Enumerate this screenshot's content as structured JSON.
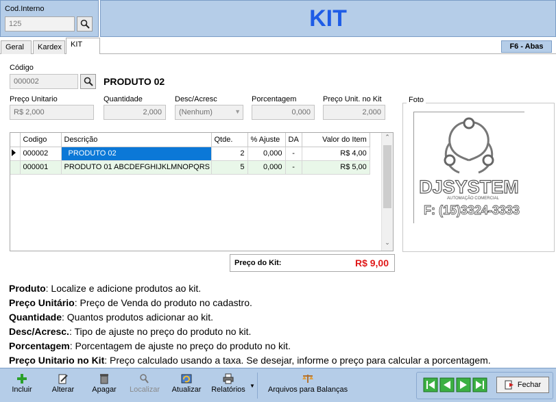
{
  "header": {
    "cod_interno_label": "Cod.Interno",
    "cod_interno_value": "125",
    "title": "KIT"
  },
  "tabs": [
    {
      "label": "Geral"
    },
    {
      "label": "Kardex"
    },
    {
      "label": "KIT"
    }
  ],
  "f6_label": "F6  - Abas",
  "form": {
    "codigo_label": "Código",
    "codigo_value": "000002",
    "product_name": "PRODUTO 02",
    "preco_unitario_label": "Preço Unitario",
    "preco_unitario_value": "R$ 2,000",
    "quantidade_label": "Quantidade",
    "quantidade_value": "2,000",
    "desc_acresc_label": "Desc/Acresc",
    "desc_acresc_value": "(Nenhum)",
    "porcentagem_label": "Porcentagem",
    "porcentagem_value": "0,000",
    "preco_kit_label": "Preço Unit. no Kit",
    "preco_kit_value": "2,000",
    "foto_label": "Foto"
  },
  "grid": {
    "columns": [
      "Codigo",
      "Descrição",
      "Qtde.",
      "% Ajuste",
      "DA",
      "Valor do Item"
    ],
    "rows": [
      {
        "codigo": "000002",
        "descricao": "PRODUTO 02",
        "qtde": "2",
        "ajuste": "0,000",
        "da": "-",
        "valor": "R$ 4,00"
      },
      {
        "codigo": "000001",
        "descricao": "PRODUTO 01 ABCDEFGHIJKLMNOPQRS",
        "qtde": "5",
        "ajuste": "0,000",
        "da": "-",
        "valor": "R$ 5,00"
      }
    ]
  },
  "price_total": {
    "label": "Preço do Kit:",
    "value": "R$ 9,00"
  },
  "logo": {
    "name": "DJSYSTEM",
    "tagline": "AUTOMAÇÃO COMERCIAL",
    "phone": "F: (15)3324-3333"
  },
  "help": [
    {
      "term": "Produto",
      "text": ": Localize e adicione produtos ao kit."
    },
    {
      "term": "Preço Unitário",
      "text": ": Preço de Venda do produto no cadastro."
    },
    {
      "term": "Quantidade",
      "text": ": Quantos produtos adicionar ao kit."
    },
    {
      "term": "Desc/Acresc.",
      "text": ": Tipo de ajuste no preço do produto no kit."
    },
    {
      "term": "Porcentagem",
      "text": ": Porcentagem de ajuste no preço do produto no kit."
    },
    {
      "term": "Preço Unitario no Kit",
      "text": ": Preço calculado usando a taxa. Se desejar, informe o preço para calcular a porcentagem."
    }
  ],
  "toolbar": {
    "incluir": "Incluir",
    "alterar": "Alterar",
    "apagar": "Apagar",
    "localizar": "Localizar",
    "atualizar": "Atualizar",
    "relatorios": "Relatórios",
    "arquivos": "Arquivos para Balanças",
    "fechar": "Fechar"
  },
  "colors": {
    "accent": "#1e5ce6",
    "panel": "#b5cde8",
    "total": "#e01818",
    "selection": "#0b78d7",
    "row_alt": "#e9f7e9"
  }
}
